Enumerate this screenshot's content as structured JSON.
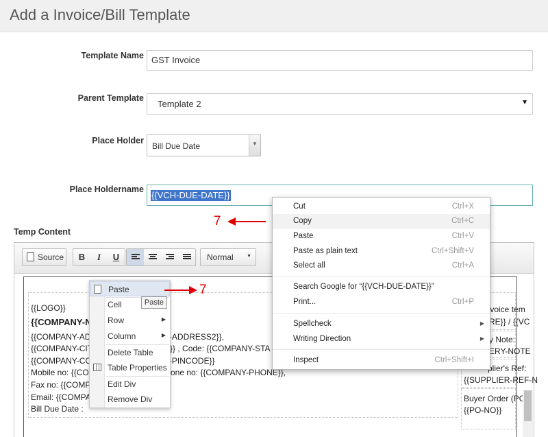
{
  "page_title": "Add a Invoice/Bill Template",
  "form": {
    "template_name_label": "Template Name",
    "template_name_value": "GST Invoice",
    "parent_template_label": "Parent Template",
    "parent_template_value": "Template 2",
    "place_holder_label": "Place Holder",
    "place_holder_value": "Bill Due Date",
    "place_holdername_label": "Place Holdername",
    "place_holdername_value": "{{VCH-DUE-DATE}}",
    "temp_content_label": "Temp Content"
  },
  "toolbar": {
    "source_label": "Source",
    "bold": "B",
    "italic": "I",
    "underline": "U",
    "format_value": "Normal"
  },
  "content": {
    "logo": "{{LOGO}}",
    "company_name": "{{COMPANY-N",
    "address_line": "{{COMPANY-AD",
    "address_line_right": "Y-ADDRESS2}},",
    "city_line": "{{COMPANY-CIT",
    "city_line_right": "E}} , Code: {{COMPANY-STA",
    "country_line": "{{COMPANY-CO",
    "country_line_right": "Y-PINCODE}}",
    "mobile_line": "Mobile no: {{CO",
    "mobile_line_right": "one no: {{COMPANY-PHONE}},",
    "fax_line": "Fax no: {{COMP",
    "email_line": "Email: {{COMPA",
    "bill_due_line": "Bill Due Date :",
    "right_invoice": "invoice tem",
    "right_pre": "PRE}} / {{VC",
    "right_delivery_note": "y Note:",
    "right_delivery_value": "VERY-NOTE",
    "right_supplier_ref": "plier's Ref:",
    "right_supplier_value": "{{SUPPLIER-REF-N",
    "right_buyer_order": "Buyer Order (PO",
    "right_po_no": "{{PO-NO}}"
  },
  "editor_menu": {
    "items": [
      {
        "label": "Paste"
      },
      {
        "label": "Cell"
      },
      {
        "label": "Row"
      },
      {
        "label": "Column"
      },
      {
        "label": "Delete Table"
      },
      {
        "label": "Table Properties"
      },
      {
        "label": "Edit Div"
      },
      {
        "label": "Remove Div"
      }
    ],
    "tooltip": "Paste"
  },
  "browser_menu": {
    "items": [
      {
        "label": "Cut",
        "shortcut": "Ctrl+X"
      },
      {
        "label": "Copy",
        "shortcut": "Ctrl+C"
      },
      {
        "label": "Paste",
        "shortcut": "Ctrl+V"
      },
      {
        "label": "Paste as plain text",
        "shortcut": "Ctrl+Shift+V"
      },
      {
        "label": "Select all",
        "shortcut": "Ctrl+A"
      },
      {
        "label": "Search Google for “{{VCH-DUE-DATE}}”",
        "shortcut": ""
      },
      {
        "label": "Print...",
        "shortcut": "Ctrl+P"
      },
      {
        "label": "Spellcheck",
        "shortcut": ""
      },
      {
        "label": "Writing Direction",
        "shortcut": ""
      },
      {
        "label": "Inspect",
        "shortcut": "Ctrl+Shift+I"
      }
    ]
  },
  "annotations": {
    "step_top": "7",
    "step_bottom": "7"
  },
  "colors": {
    "selection": "#3f76c9",
    "annotation": "#e00000"
  }
}
